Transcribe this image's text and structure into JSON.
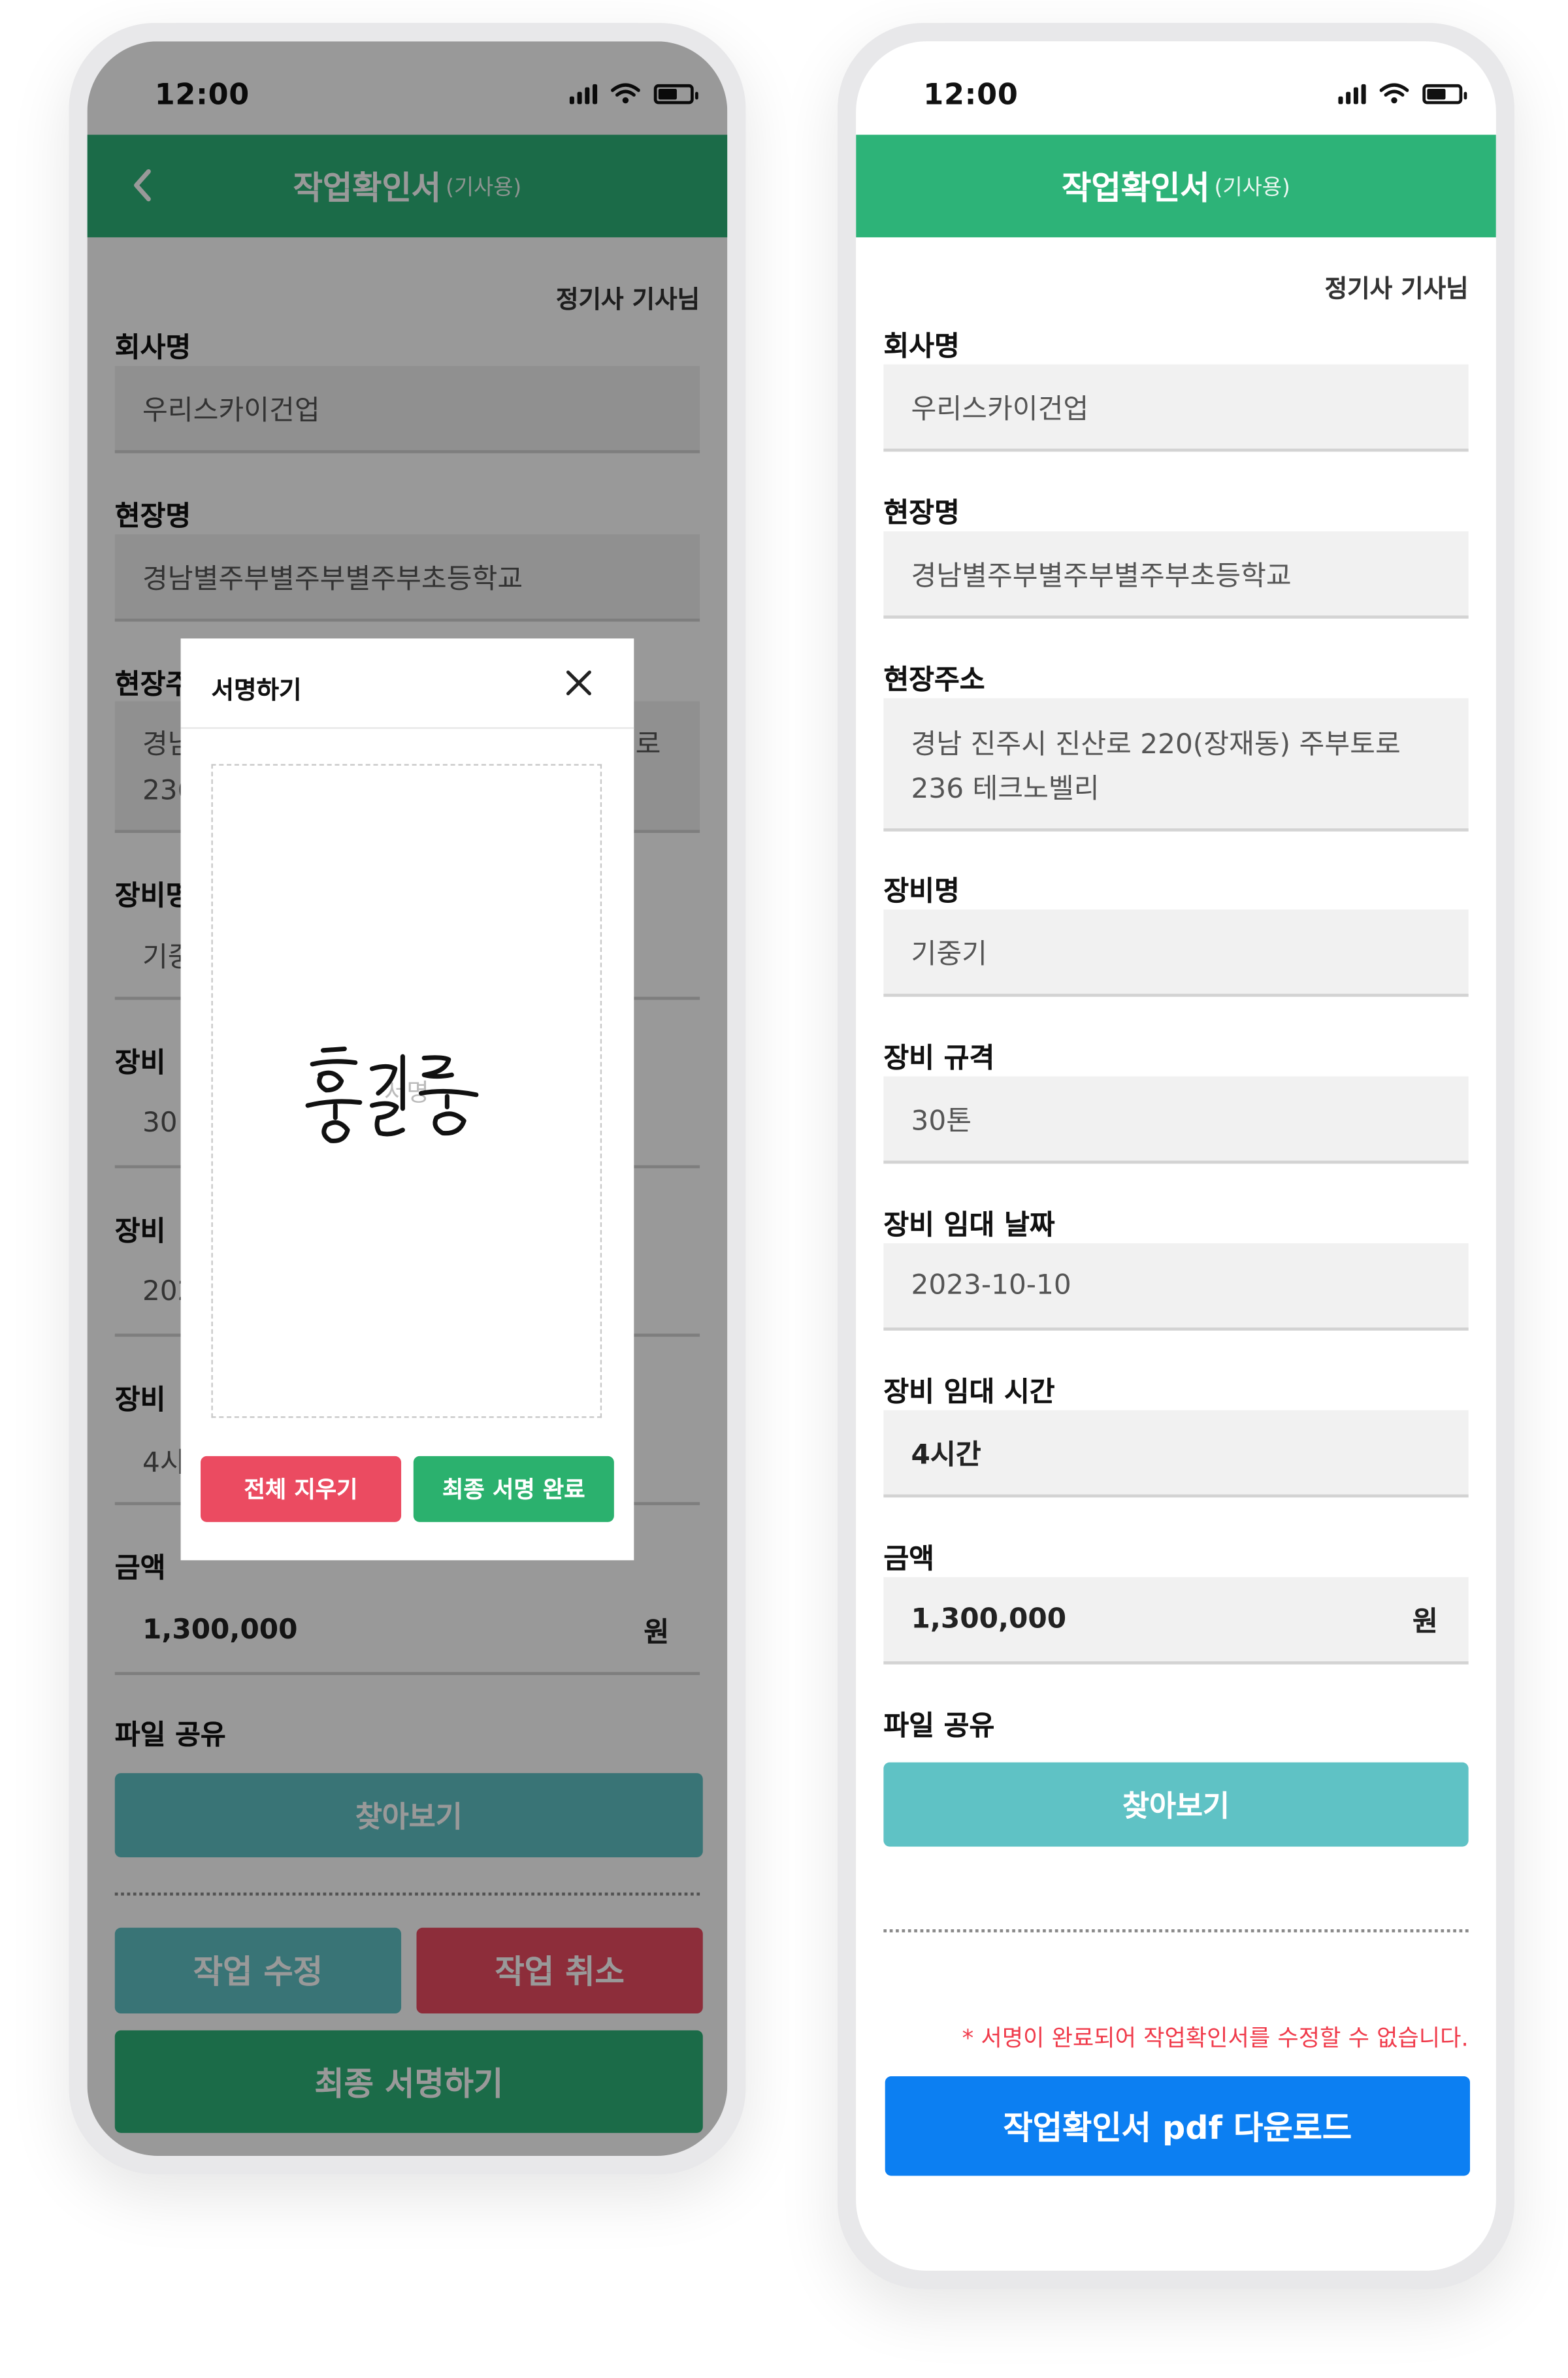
{
  "status": {
    "time": "12:00"
  },
  "header": {
    "title": "작업확인서",
    "subtitle": "(기사용)"
  },
  "user": "정기사 기사님",
  "fields": {
    "company": {
      "label": "회사명",
      "value": "우리스카이건업"
    },
    "site": {
      "label": "현장명",
      "value": "경남별주부별주부별주부초등학교"
    },
    "address": {
      "label": "현장주소",
      "value_line1": "경남 진주시 진산로 220(장재동) 주부토로",
      "value_line2": "236 테크노벨리"
    },
    "equipment": {
      "label": "장비명",
      "value": "기중기"
    },
    "spec": {
      "label": "장비 규격",
      "value": "30톤"
    },
    "date": {
      "label": "장비 임대 날짜",
      "value": "2023-10-10"
    },
    "time": {
      "label": "장비 임대 시간",
      "value": "4시간"
    },
    "amount": {
      "label": "금액",
      "value": "1,300,000",
      "unit": "원"
    },
    "file": {
      "label": "파일 공유",
      "button": "찾아보기"
    }
  },
  "left_screen": {
    "truncated": {
      "address_label": "현장주",
      "address_l1_left": "경남",
      "address_l1_right": "로",
      "address_l2_left": "236",
      "equipment_label": "장비명",
      "equipment_value": "기중",
      "spec_label": "장비 ",
      "spec_value": "30",
      "date_label": "장비 ",
      "date_value": "202",
      "time_label": "장비 ",
      "time_value": "4시"
    },
    "buttons": {
      "edit": "작업 수정",
      "cancel": "작업 취소",
      "final_sign": "최종 서명하기"
    },
    "modal": {
      "title": "서명하기",
      "placeholder": "서명",
      "clear": "전체 지우기",
      "complete": "최종 서명 완료"
    }
  },
  "right_screen": {
    "notice": "* 서명이 완료되어 작업확인서를 수정할 수 없습니다.",
    "download": "작업확인서 pdf 다운로드"
  },
  "colors": {
    "header_green": "#2db378",
    "teal": "#5fc2c5",
    "red": "#eb4b61",
    "sign_green": "#2bb16e",
    "blue": "#0c7ff2",
    "notice": "#f03b4b"
  }
}
